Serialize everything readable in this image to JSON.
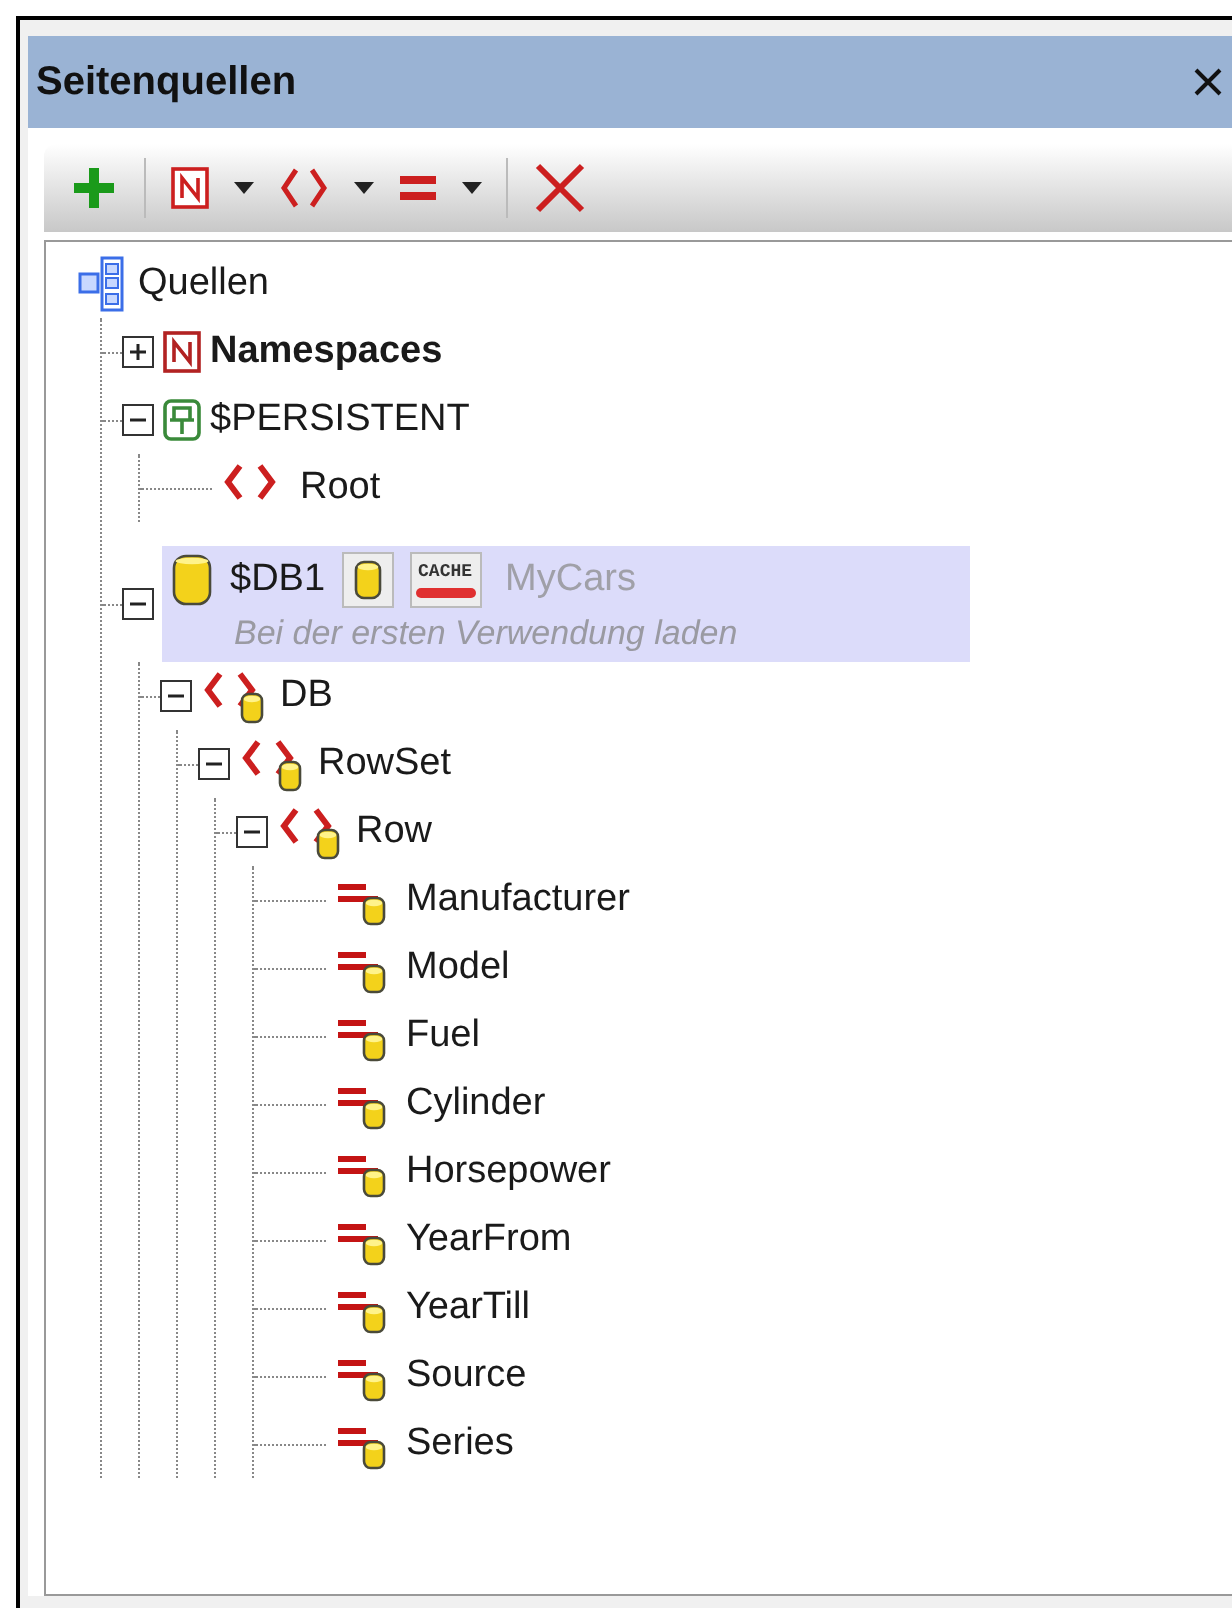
{
  "panel": {
    "title": "Seitenquellen"
  },
  "tree": {
    "label": "Quellen",
    "kind": "sources",
    "selected": false,
    "children": [
      {
        "label": "Namespaces",
        "kind": "namespaces",
        "bold": true,
        "selected": false,
        "expanded": false
      },
      {
        "label": "$PERSISTENT",
        "kind": "persistent",
        "selected": false,
        "expanded": true,
        "children": [
          {
            "label": "Root",
            "kind": "element",
            "selected": false
          }
        ]
      },
      {
        "label": "$DB1",
        "kind": "database",
        "selected": true,
        "expanded": true,
        "source": "MyCars",
        "cache_label": "CACHE",
        "note": "Bei der ersten Verwendung laden",
        "children": [
          {
            "label": "DB",
            "kind": "db-element",
            "selected": false,
            "expanded": true,
            "children": [
              {
                "label": "RowSet",
                "kind": "db-element",
                "selected": false,
                "expanded": true,
                "children": [
                  {
                    "label": "Row",
                    "kind": "db-element",
                    "selected": false,
                    "expanded": true,
                    "children": [
                      {
                        "label": "Manufacturer",
                        "kind": "db-field",
                        "selected": false
                      },
                      {
                        "label": "Model",
                        "kind": "db-field",
                        "selected": false
                      },
                      {
                        "label": "Fuel",
                        "kind": "db-field",
                        "selected": false
                      },
                      {
                        "label": "Cylinder",
                        "kind": "db-field",
                        "selected": false
                      },
                      {
                        "label": "Horsepower",
                        "kind": "db-field",
                        "selected": false
                      },
                      {
                        "label": "YearFrom",
                        "kind": "db-field",
                        "selected": false
                      },
                      {
                        "label": "YearTill",
                        "kind": "db-field",
                        "selected": false
                      },
                      {
                        "label": "Source",
                        "kind": "db-field",
                        "selected": false
                      },
                      {
                        "label": "Series",
                        "kind": "db-field",
                        "selected": false
                      }
                    ]
                  }
                ]
              }
            ]
          }
        ]
      }
    ]
  }
}
